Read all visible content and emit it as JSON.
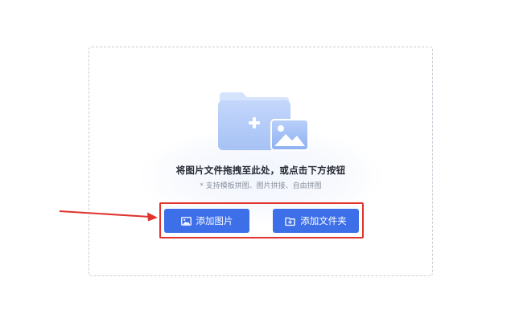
{
  "upload": {
    "main_text": "将图片文件拖拽至此处，或点击下方按钮",
    "sub_text": "* 支持模板拼图、图片拼接、自由拼图"
  },
  "buttons": {
    "add_image": "添加图片",
    "add_folder": "添加文件夹"
  },
  "icons": {
    "illustration": "folder-plus-image-icon",
    "add_image_icon": "image-icon",
    "add_folder_icon": "folder-plus-icon"
  },
  "colors": {
    "accent": "#3d6fe8",
    "annotation": "#e0332e",
    "illustration": "#a9c4f6"
  }
}
